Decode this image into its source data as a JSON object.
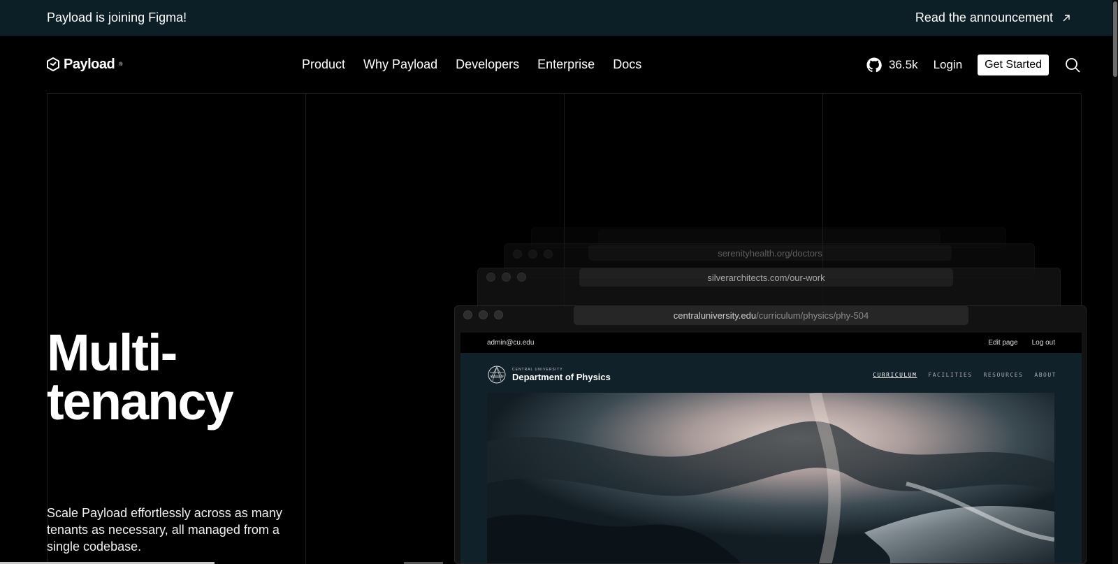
{
  "announcement": {
    "text": "Payload is joining Figma!",
    "link": "Read the announcement"
  },
  "nav": {
    "logo": "Payload",
    "items": [
      "Product",
      "Why Payload",
      "Developers",
      "Enterprise",
      "Docs"
    ],
    "github_stars": "36.5k",
    "login": "Login",
    "cta": "Get Started"
  },
  "hero": {
    "title_line1": "Multi-",
    "title_line2": "tenancy",
    "description": "Scale Payload effortlessly across as many tenants as necessary, all managed from a single codebase."
  },
  "windows": {
    "back": {
      "url": "serenityhealth.org/doctors"
    },
    "middle": {
      "url": "silverarchitects.com/our-work"
    },
    "front": {
      "url_host": "centraluniversity.edu",
      "url_path": "/curriculum/physics/phy-504",
      "admin_email": "admin@cu.edu",
      "edit_page": "Edit page",
      "log_out": "Log out",
      "site_small": "CENTRAL UNIVERSITY",
      "site_name": "Department of Physics",
      "site_menu": [
        "CURRICULUM",
        "FACILITIES",
        "RESOURCES",
        "ABOUT"
      ]
    }
  }
}
